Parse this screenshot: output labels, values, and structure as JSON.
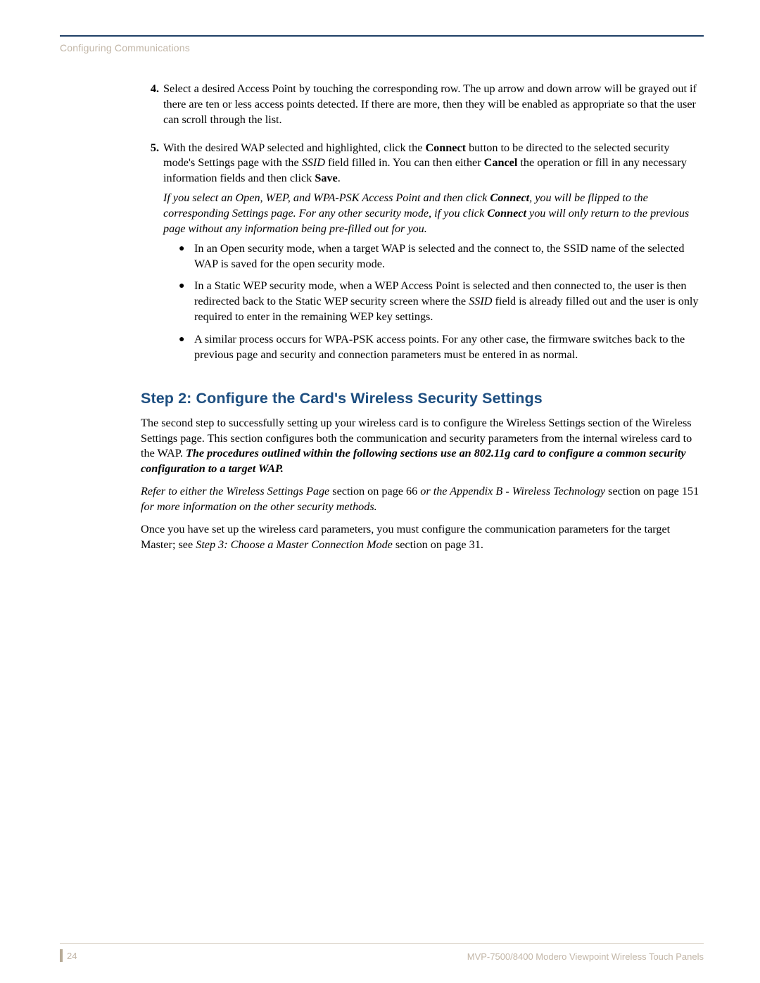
{
  "header": {
    "section_title": "Configuring Communications"
  },
  "steps": [
    {
      "num": "4.",
      "text_parts": [
        {
          "t": "Select a desired Access Point by touching the corresponding row. The up arrow and down arrow will be grayed out if there are ten or less access points detected. If there are more, then they will be enabled as appropriate so that the user can scroll through the list."
        }
      ]
    },
    {
      "num": "5.",
      "text_parts": [
        {
          "t": "With the desired WAP selected and highlighted, click the "
        },
        {
          "t": "Connect",
          "cls": "bold"
        },
        {
          "t": " button to be directed to the selected security mode's Settings page with the "
        },
        {
          "t": "SSID",
          "cls": "italic"
        },
        {
          "t": " field filled in. You can then either "
        },
        {
          "t": "Cancel",
          "cls": "bold"
        },
        {
          "t": " the operation or fill in any necessary information fields and then click "
        },
        {
          "t": "Save",
          "cls": "bold"
        },
        {
          "t": "."
        }
      ],
      "note_parts": [
        {
          "t": "If you select an Open, WEP, and WPA-PSK Access Point and then click ",
          "cls": "italic"
        },
        {
          "t": "Connect",
          "cls": "bold-italic"
        },
        {
          "t": ", you will be flipped to the corresponding Settings page. For any other security mode, if you click ",
          "cls": "italic"
        },
        {
          "t": "Connect",
          "cls": "bold-italic"
        },
        {
          "t": " you will only return to the previous page without any information being pre-filled out for you.",
          "cls": "italic"
        }
      ],
      "bullets": [
        [
          {
            "t": "In an Open security mode, when a target WAP is selected and the connect to, the SSID name of the selected WAP is saved for the open security mode."
          }
        ],
        [
          {
            "t": "In a Static WEP security mode, when a WEP Access Point is selected and then connected to, the user is then redirected back to the Static WEP security screen where the "
          },
          {
            "t": "SSID",
            "cls": "italic"
          },
          {
            "t": " field is already filled out and the user is only required to enter in the remaining WEP key settings."
          }
        ],
        [
          {
            "t": "A similar process occurs for WPA-PSK access points. For any other case, the firmware switches back to the previous page and security and connection parameters must be entered in as normal."
          }
        ]
      ]
    }
  ],
  "step2": {
    "heading": "Step 2: Configure the Card's Wireless Security Settings",
    "p1_parts": [
      {
        "t": "The second step to successfully setting up your wireless card is to configure the Wireless Settings section of the Wireless Settings page. This section configures both the communication and security parameters from the internal wireless card to the WAP. "
      },
      {
        "t": "The procedures outlined within the following sections use an 802.11g card to configure a common security configuration to a target WAP.",
        "cls": "bold-italic"
      }
    ],
    "p2_parts": [
      {
        "t": "Refer to either the Wireless Settings Page",
        "cls": "italic"
      },
      {
        "t": " section on page 66 "
      },
      {
        "t": "or the Appendix B - Wireless Technology",
        "cls": "italic"
      },
      {
        "t": " section on page 151 "
      },
      {
        "t": "for more information on the other security methods.",
        "cls": "italic"
      }
    ],
    "p3_parts": [
      {
        "t": "Once you have set up the wireless card parameters, you must configure the communication parameters for the target Master; see "
      },
      {
        "t": "Step 3: Choose a Master Connection Mode",
        "cls": "italic"
      },
      {
        "t": " section on page 31."
      }
    ]
  },
  "footer": {
    "page_number": "24",
    "doc_title": "MVP-7500/8400 Modero Viewpoint Wireless Touch Panels"
  }
}
